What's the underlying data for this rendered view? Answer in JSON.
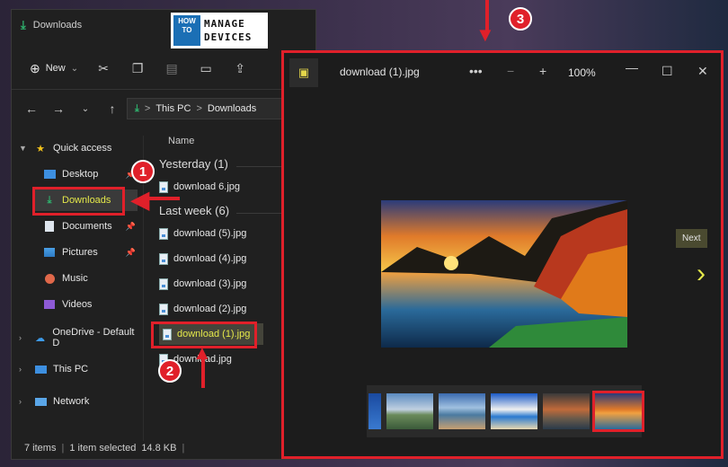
{
  "explorer": {
    "title": "Downloads",
    "toolbar": {
      "new_label": "New",
      "new_caret": "⌄"
    },
    "address": {
      "this_pc": "This PC",
      "sep": ">",
      "folder": "Downloads"
    },
    "sidebar": {
      "quick_access": "Quick access",
      "desktop": "Desktop",
      "downloads": "Downloads",
      "documents": "Documents",
      "pictures": "Pictures",
      "music": "Music",
      "videos": "Videos",
      "onedrive": "OneDrive - Default D",
      "this_pc": "This PC",
      "network": "Network"
    },
    "files": {
      "column_name": "Name",
      "group_yesterday": "Yesterday (1)",
      "group_lastweek": "Last week (6)",
      "items": [
        "download 6.jpg",
        "download (5).jpg",
        "download (4).jpg",
        "download (3).jpg",
        "download (2).jpg",
        "download (1).jpg",
        "download.jpg"
      ]
    },
    "status": {
      "count": "7 items",
      "sep": "|",
      "selected": "1 item selected",
      "size": "14.8 KB"
    }
  },
  "logo": {
    "how": "HOW TO",
    "manage": "MANAGE",
    "devices": "DEVICES"
  },
  "viewer": {
    "title": "download (1).jpg",
    "more": "•••",
    "zoom_out": "−",
    "zoom_in": "+",
    "zoom": "100%",
    "minimize": "—",
    "maximize": "☐",
    "close": "✕",
    "next_tooltip": "Next",
    "next_arrow": "›"
  },
  "annotations": {
    "one": "1",
    "two": "2",
    "three": "3"
  },
  "colors": {
    "highlight": "#e0202a",
    "accent_yellow": "#e4e84a",
    "downloads_green": "#2fb36e"
  }
}
